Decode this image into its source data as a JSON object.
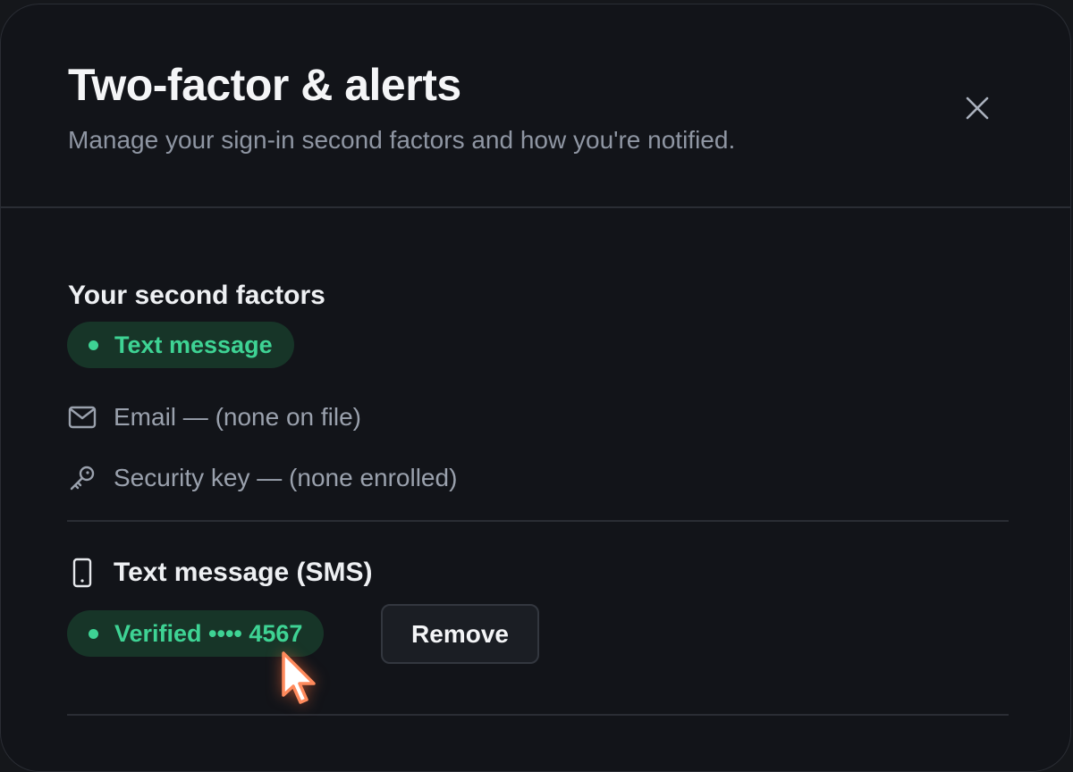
{
  "dialog": {
    "title": "Two-factor & alerts",
    "subtitle": "Manage your sign-in second factors and how you're notified."
  },
  "icons": {
    "close": "close-icon",
    "email": "mail-icon",
    "key": "key-icon",
    "phone": "phone-icon",
    "cursor": "mouse-pointer-icon"
  },
  "factors": {
    "section_title": "Your second factors",
    "active_label": "Text message",
    "email_label": "Email — (none on file)",
    "key_label": "Security key — (none enrolled)"
  },
  "sms": {
    "title": "Text message (SMS)",
    "status_label": "Verified •••• 4567",
    "remove_label": "Remove"
  },
  "colors": {
    "background": "#121419",
    "accent_green": "#3ed394",
    "pill_background": "#173528",
    "text_primary": "#f4f5f7",
    "text_secondary": "#8f96a3",
    "cursor_accent": "#ff8a5c"
  }
}
